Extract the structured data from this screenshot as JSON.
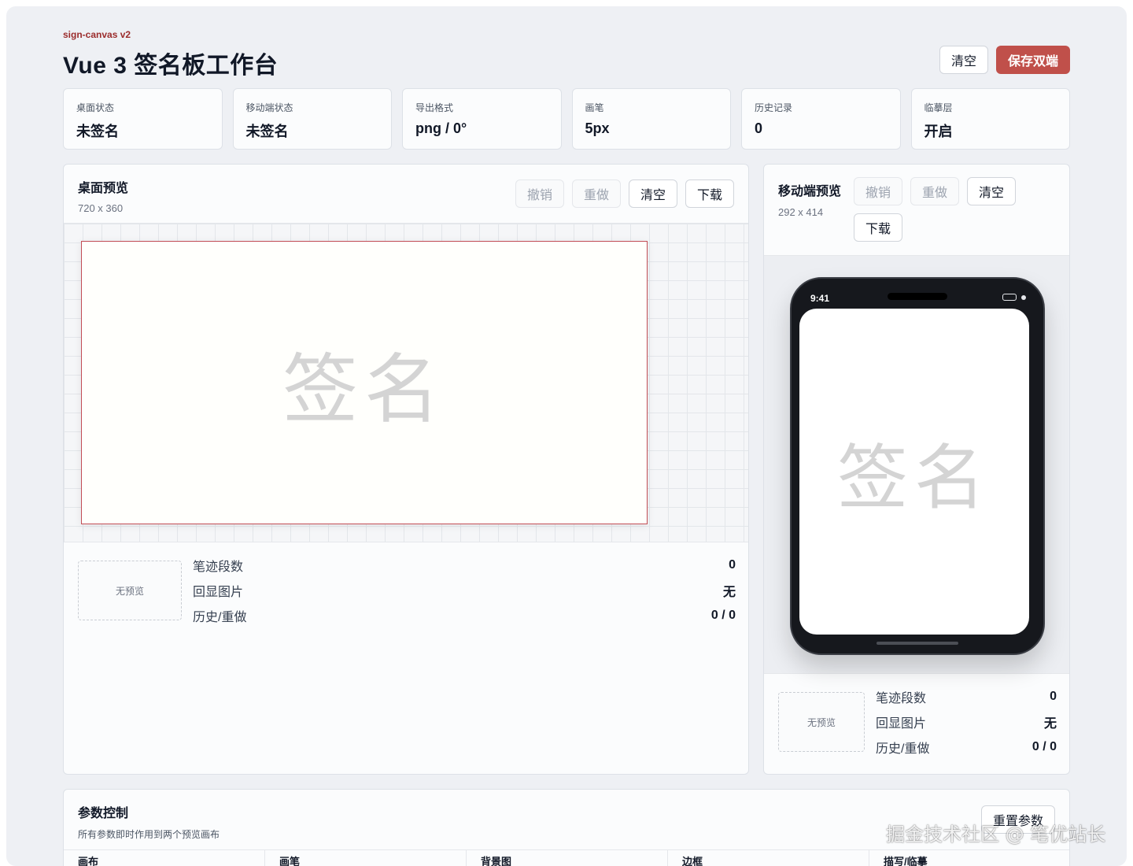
{
  "header": {
    "eyebrow": "sign-canvas v2",
    "title": "Vue 3 签名板工作台",
    "clear_label": "清空",
    "save_label": "保存双端"
  },
  "stats": [
    {
      "label": "桌面状态",
      "value": "未签名"
    },
    {
      "label": "移动端状态",
      "value": "未签名"
    },
    {
      "label": "导出格式",
      "value": "png / 0°"
    },
    {
      "label": "画笔",
      "value": "5px"
    },
    {
      "label": "历史记录",
      "value": "0"
    },
    {
      "label": "临摹层",
      "value": "开启"
    }
  ],
  "desktop": {
    "title": "桌面预览",
    "size": "720 x 360",
    "undo_label": "撤销",
    "redo_label": "重做",
    "clear_label": "清空",
    "download_label": "下载",
    "watermark": "签名",
    "preview_placeholder": "无预览",
    "info": [
      {
        "key": "笔迹段数",
        "value": "0"
      },
      {
        "key": "回显图片",
        "value": "无"
      },
      {
        "key": "历史/重做",
        "value": "0 / 0"
      }
    ]
  },
  "mobile": {
    "title": "移动端预览",
    "size": "292 x 414",
    "undo_label": "撤销",
    "redo_label": "重做",
    "clear_label": "清空",
    "download_label": "下载",
    "status_time": "9:41",
    "watermark": "签名",
    "preview_placeholder": "无预览",
    "info": [
      {
        "key": "笔迹段数",
        "value": "0"
      },
      {
        "key": "回显图片",
        "value": "无"
      },
      {
        "key": "历史/重做",
        "value": "0 / 0"
      }
    ]
  },
  "params": {
    "title": "参数控制",
    "subtitle": "所有参数即时作用到两个预览画布",
    "reset_label": "重置参数",
    "columns": [
      "画布",
      "画笔",
      "背景图",
      "边框",
      "描写/临摹"
    ]
  },
  "site_watermark": "掘金技术社区 @ 笔优站长",
  "colors": {
    "accent": "#c0504a",
    "eyebrow": "#9b2c2c",
    "canvas_border": "#c24d55"
  }
}
